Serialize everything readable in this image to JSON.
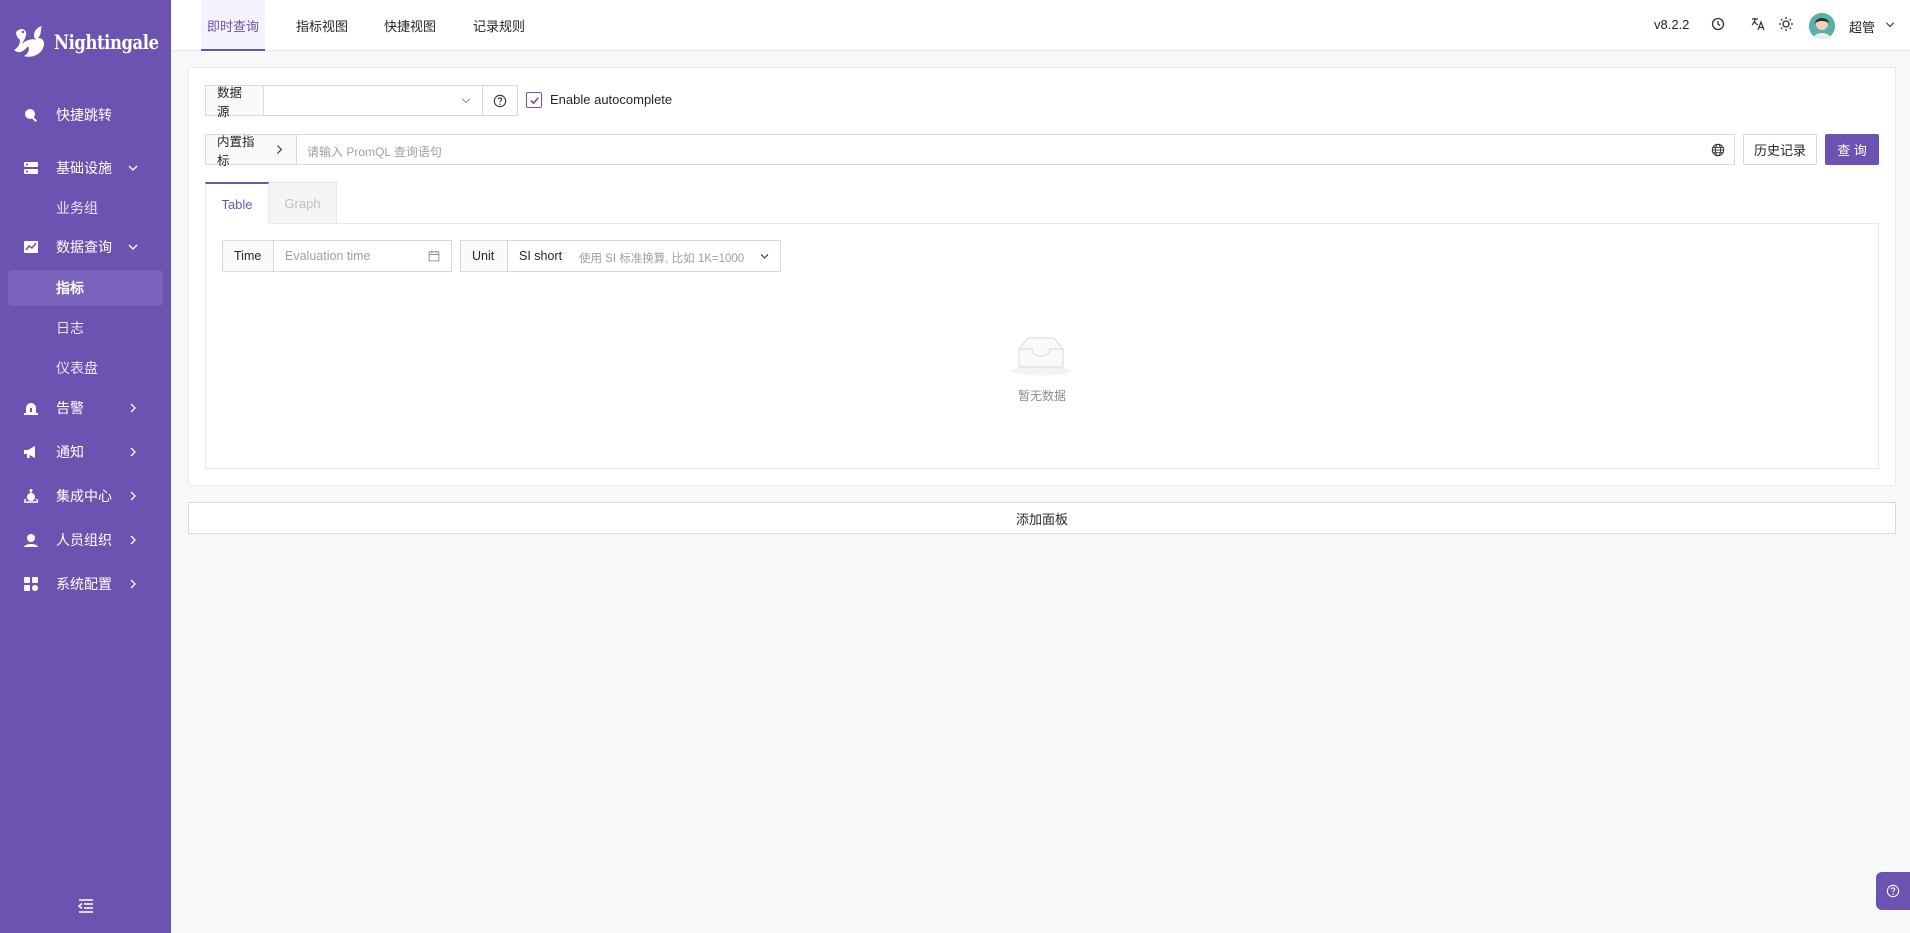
{
  "app": {
    "logo_text": "Nightingale"
  },
  "sidebar": {
    "quick_jump": "快捷跳转",
    "infra": "基础设施",
    "infra_sub": [
      "业务组"
    ],
    "data_query": "数据查询",
    "data_query_sub": [
      "指标",
      "日志",
      "仪表盘"
    ],
    "alert": "告警",
    "notify": "通知",
    "integration": "集成中心",
    "people": "人员组织",
    "system": "系统配置"
  },
  "topbar": {
    "tabs": [
      "即时查询",
      "指标视图",
      "快捷视图",
      "记录规则"
    ],
    "version": "v8.2.2",
    "user": "超管"
  },
  "query": {
    "datasource_label": "数据源",
    "datasource_value": "",
    "autocomplete_label": "Enable autocomplete",
    "autocomplete_checked": true,
    "builtin_metrics": "内置指标",
    "placeholder": "请输入 PromQL 查询语句",
    "history_button": "历史记录",
    "query_button": "查 询"
  },
  "result_tabs": [
    "Table",
    "Graph"
  ],
  "table_controls": {
    "time_label": "Time",
    "time_placeholder": "Evaluation time",
    "unit_label": "Unit",
    "unit_value": "SI short",
    "unit_hint": "使用 SI 标准换算, 比如 1K=1000"
  },
  "empty_text": "暂无数据",
  "add_panel": "添加面板",
  "colors": {
    "accent": "#6c53b1",
    "sidebar_bg": "#6c53b1"
  }
}
